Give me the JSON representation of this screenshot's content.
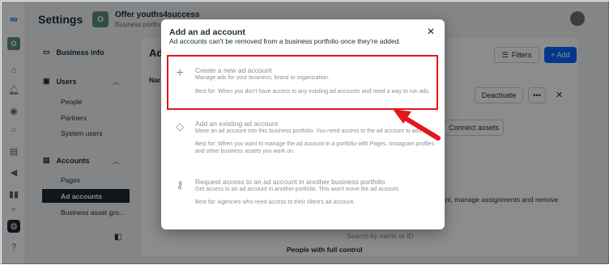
{
  "header": {
    "title": "Settings",
    "business_initial": "O",
    "business_name": "Offer youths4success",
    "business_sub": "Business portfo"
  },
  "rail": {
    "workspace_initial": "O",
    "icons": [
      "meta-logo-icon",
      "home-icon",
      "bell-icon",
      "compass-icon",
      "chat-icon",
      "news-icon",
      "megaphone-icon",
      "insights-icon",
      "search-icon",
      "settings-icon",
      "help-icon"
    ]
  },
  "sidebar": {
    "business_info": "Business info",
    "users": "Users",
    "users_items": [
      "People",
      "Partners",
      "System users"
    ],
    "accounts": "Accounts",
    "accounts_items": [
      "Pages",
      "Ad accounts",
      "Business asset gro..."
    ]
  },
  "background": {
    "heading_partial": "Ad",
    "col_partial": "Nar",
    "filters_label": "Filters",
    "add_label": "+ Add",
    "deactivate_label": "Deactivate",
    "more_label": "•••",
    "connect_label": "Connect assets",
    "bg_line": "ount, manage assignments and remove",
    "search_placeholder": "Search by name or ID",
    "section_partial": "People with full control"
  },
  "modal": {
    "title": "Add an ad account",
    "subtitle": "Ad accounts can't be removed from a business portfolio once they're added.",
    "options": [
      {
        "icon": "plus-icon",
        "title": "Create a new ad account",
        "description": "Manage ads for your business, brand or organization.",
        "best_for": "Best for: When you don't have access to any existing ad accounts and need a way to run ads."
      },
      {
        "icon": "tag-icon",
        "title": "Add an existing ad account",
        "description": "Move an ad account into this business portfolio. You need access to the ad account to add it.",
        "best_for": "Best for: When you want to manage the ad account in a portfolio with Pages, Instagram profiles and other business assets you work on."
      },
      {
        "icon": "key-icon",
        "title": "Request access to an ad account in another business portfolio",
        "description": "Get access to an ad account in another portfolio. This won't move the ad account.",
        "best_for": "Best for: Agencies who need access to their client's ad account."
      }
    ]
  },
  "colors": {
    "highlight": "#e3161b",
    "primary": "#0866ff",
    "dark": "#1c2b33"
  }
}
